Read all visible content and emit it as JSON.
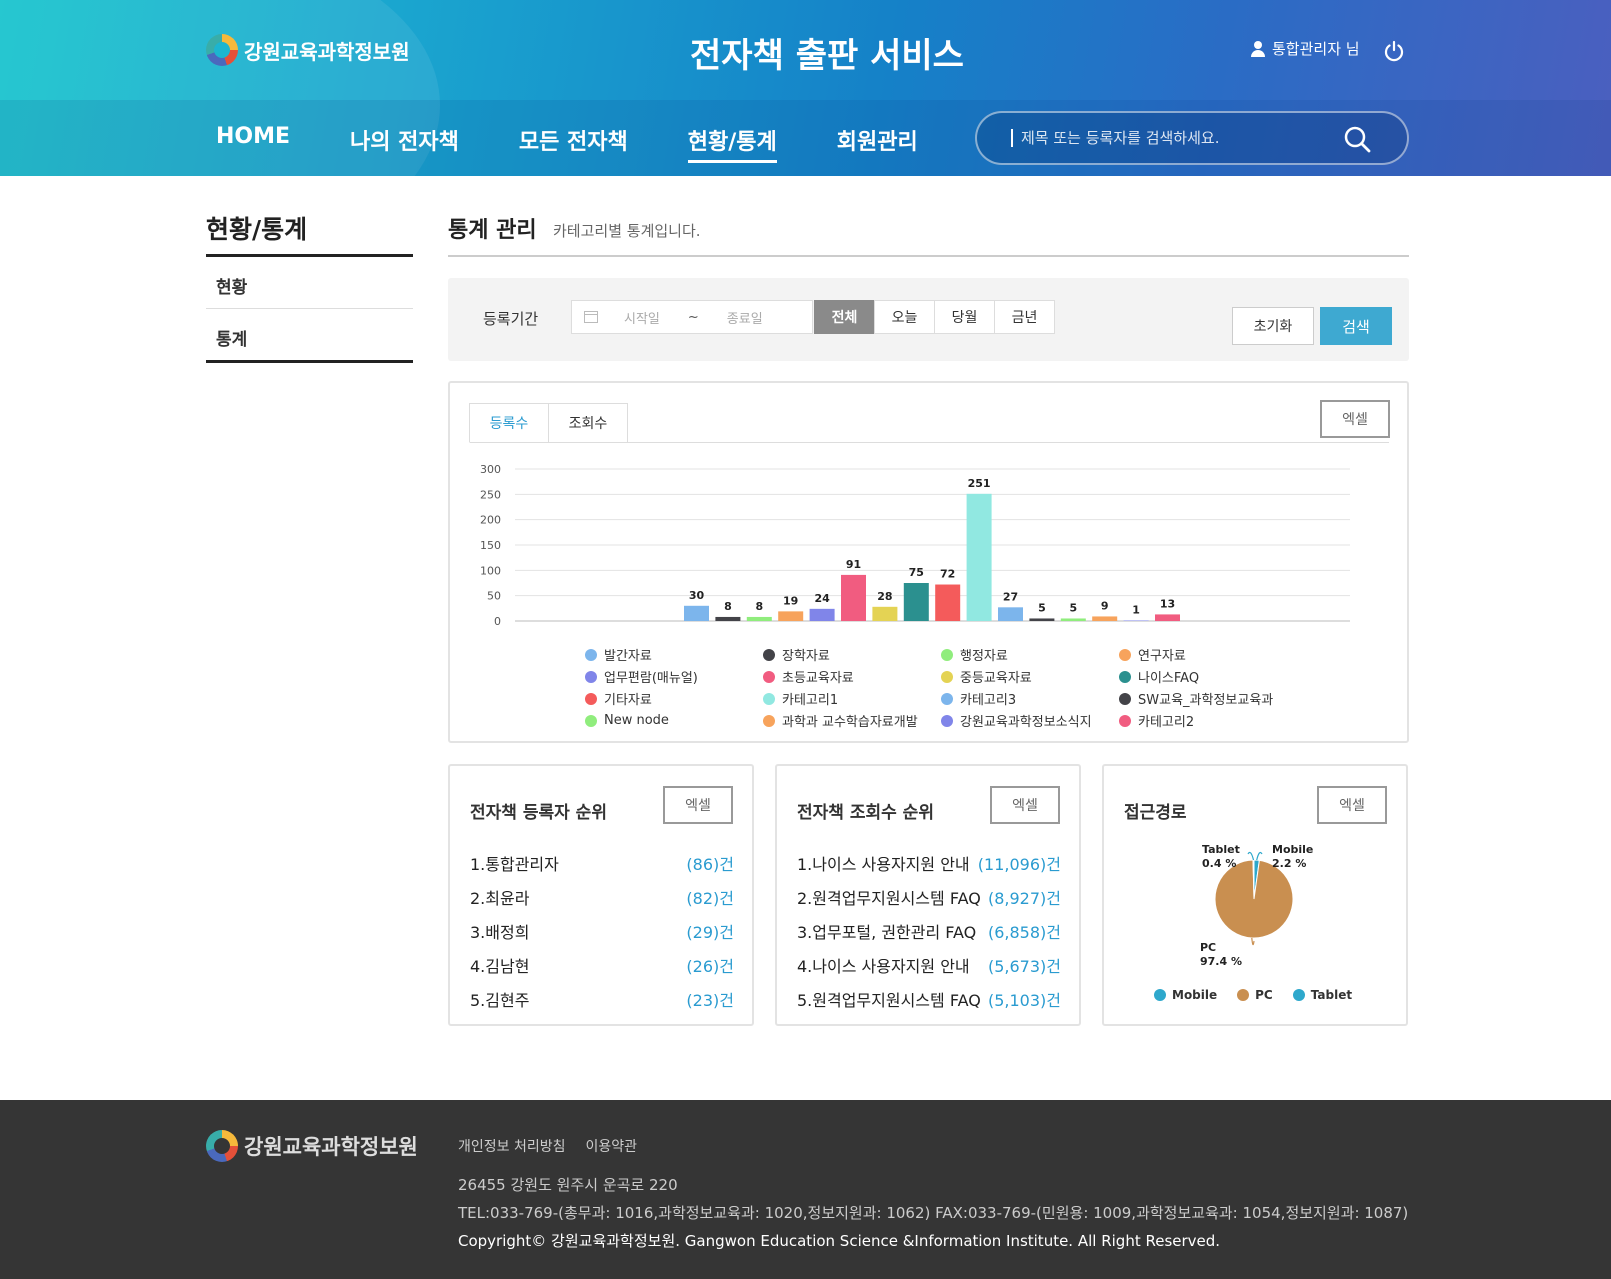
{
  "header": {
    "logo_text": "강원교육과학정보원",
    "site_title": "전자책 출판 서비스",
    "user_name": "통합관리자 님",
    "nav": [
      "HOME",
      "나의 전자책",
      "모든 전자책",
      "현황/통계",
      "회원관리"
    ],
    "active_nav": "현황/통계",
    "search_placeholder": "제목 또는 등록자를 검색하세요."
  },
  "sidebar": {
    "title": "현황/통계",
    "items": [
      "현황",
      "통계"
    ]
  },
  "content": {
    "title": "통계 관리",
    "subtitle": "카테고리별 통계입니다."
  },
  "filter": {
    "label": "등록기간",
    "start_placeholder": "시작일",
    "separator": "~",
    "end_placeholder": "종료일",
    "periods": [
      "전체",
      "오늘",
      "당월",
      "금년"
    ],
    "active_period": "전체",
    "reset_label": "초기화",
    "search_label": "검색"
  },
  "chart_panel": {
    "tabs": [
      "등록수",
      "조회수"
    ],
    "active_tab": "등록수",
    "excel_label": "엑셀"
  },
  "chart_data": {
    "type": "bar",
    "categories": [
      "발간자료",
      "장학자료",
      "행정자료",
      "연구자료",
      "업무편람(매뉴얼)",
      "초등교육자료",
      "중등교육자료",
      "나이스FAQ",
      "기타자료",
      "카테고리1",
      "카테고리3",
      "SW교육_과학정보교육과",
      "New node",
      "과학과 교수학습자료개발",
      "강원교육과학정보소식지",
      "카테고리2"
    ],
    "values": [
      30,
      8,
      8,
      19,
      24,
      91,
      28,
      75,
      72,
      251,
      27,
      5,
      5,
      9,
      1,
      13
    ],
    "colors": [
      "#7cb5ec",
      "#434348",
      "#90ed7d",
      "#f7a35c",
      "#8085e9",
      "#f15c80",
      "#e4d354",
      "#2b908f",
      "#f45b5b",
      "#91e8e1",
      "#7cb5ec",
      "#434348",
      "#90ed7d",
      "#f7a35c",
      "#8085e9",
      "#f15c80"
    ],
    "ylim": [
      0,
      300
    ],
    "yticks": [
      0,
      50,
      100,
      150,
      200,
      250,
      300
    ],
    "grid": true,
    "legend_position": "bottom"
  },
  "registrant_rank": {
    "title": "전자책 등록자 순위",
    "excel_label": "엑셀",
    "items": [
      {
        "name": "1.통합관리자",
        "count": "(86)",
        "unit": "건"
      },
      {
        "name": "2.최윤라",
        "count": "(82)",
        "unit": "건"
      },
      {
        "name": "3.배정희",
        "count": "(29)",
        "unit": "건"
      },
      {
        "name": "4.김남현",
        "count": "(26)",
        "unit": "건"
      },
      {
        "name": "5.김현주",
        "count": "(23)",
        "unit": "건"
      }
    ]
  },
  "view_rank": {
    "title": "전자책 조회수 순위",
    "excel_label": "엑셀",
    "items": [
      {
        "name": "1.나이스 사용자지원 안내",
        "count": "(11,096)",
        "unit": "건"
      },
      {
        "name": "2.원격업무지원시스템 FAQ",
        "count": "(8,927)",
        "unit": "건"
      },
      {
        "name": "3.업무포털, 권한관리 FAQ",
        "count": "(6,858)",
        "unit": "건"
      },
      {
        "name": "4.나이스 사용자지원 안내",
        "count": "(5,673)",
        "unit": "건"
      },
      {
        "name": "5.원격업무지원시스템 FAQ",
        "count": "(5,103)",
        "unit": "건"
      }
    ]
  },
  "access": {
    "title": "접근경로",
    "excel_label": "엑셀",
    "pie": [
      {
        "name": "Mobile",
        "value": 2.2,
        "label": "2.2 %",
        "color": "#2ea8cc"
      },
      {
        "name": "PC",
        "value": 97.4,
        "label": "97.4 %",
        "color": "#c98f50"
      },
      {
        "name": "Tablet",
        "value": 0.4,
        "label": "0.4 %",
        "color": "#2ea8cc"
      }
    ],
    "legend": [
      "Mobile",
      "PC",
      "Tablet"
    ]
  },
  "footer": {
    "logo_text": "강원교육과학정보원",
    "links": [
      "개인정보 처리방침",
      "이용약관"
    ],
    "address": "26455 강원도 원주시 운곡로 220",
    "tel": "TEL:033-769-(총무과: 1016,과학정보교육과: 1020,정보지원과: 1062) FAX:033-769-(민원용: 1009,과학정보교육과: 1054,정보지원과: 1087)",
    "copyright": "Copyright© 강원교육과학정보원. Gangwon Education Science &Information Institute. All Right Reserved."
  }
}
